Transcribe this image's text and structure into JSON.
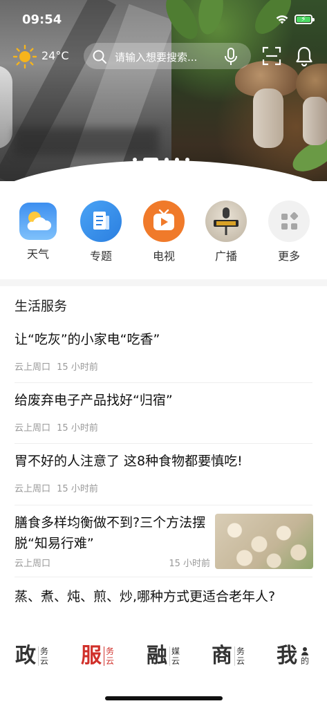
{
  "status_bar": {
    "time": "09:54",
    "battery_color": "#4cd964"
  },
  "header": {
    "weather_icon": "sun-icon",
    "temperature": "24°C",
    "search_placeholder": "请输入想要搜索...",
    "icons": [
      "search-icon",
      "microphone-icon",
      "scan-icon",
      "bell-icon"
    ]
  },
  "banner": {
    "slide_count": 5,
    "active_slide": 2
  },
  "quick_links": [
    {
      "label": "天气",
      "icon": "weather-icon"
    },
    {
      "label": "专题",
      "icon": "document-icon"
    },
    {
      "label": "电视",
      "icon": "tv-icon"
    },
    {
      "label": "广播",
      "icon": "radio-icon"
    },
    {
      "label": "更多",
      "icon": "grid-icon"
    }
  ],
  "section": {
    "title": "生活服务",
    "items": [
      {
        "title": "让“吃灰”的小家电“吃香”",
        "source": "云上周口",
        "time": "15 小时前"
      },
      {
        "title": "给废弃电子产品找好“归宿”",
        "source": "云上周口",
        "time": "15 小时前"
      },
      {
        "title": "胃不好的人注意了 这8种食物都要慎吃!",
        "source": "云上周口",
        "time": "15 小时前"
      },
      {
        "title": "膳食多样均衡做不到?三个方法摆脱“知易行难”",
        "source": "云上周口",
        "time": "15 小时前"
      },
      {
        "title": "蒸、煮、炖、煎、炒,哪种方式更适合老年人?"
      }
    ]
  },
  "tabs": [
    {
      "main": "政",
      "sub1": "务",
      "sub2": "云"
    },
    {
      "main": "服",
      "sub1": "务",
      "sub2": "云",
      "active": true
    },
    {
      "main": "融",
      "sub1": "媒",
      "sub2": "云"
    },
    {
      "main": "商",
      "sub1": "务",
      "sub2": "云"
    },
    {
      "main": "我",
      "sub1": "",
      "sub2": "的"
    }
  ],
  "accent_color": "#d0302a"
}
